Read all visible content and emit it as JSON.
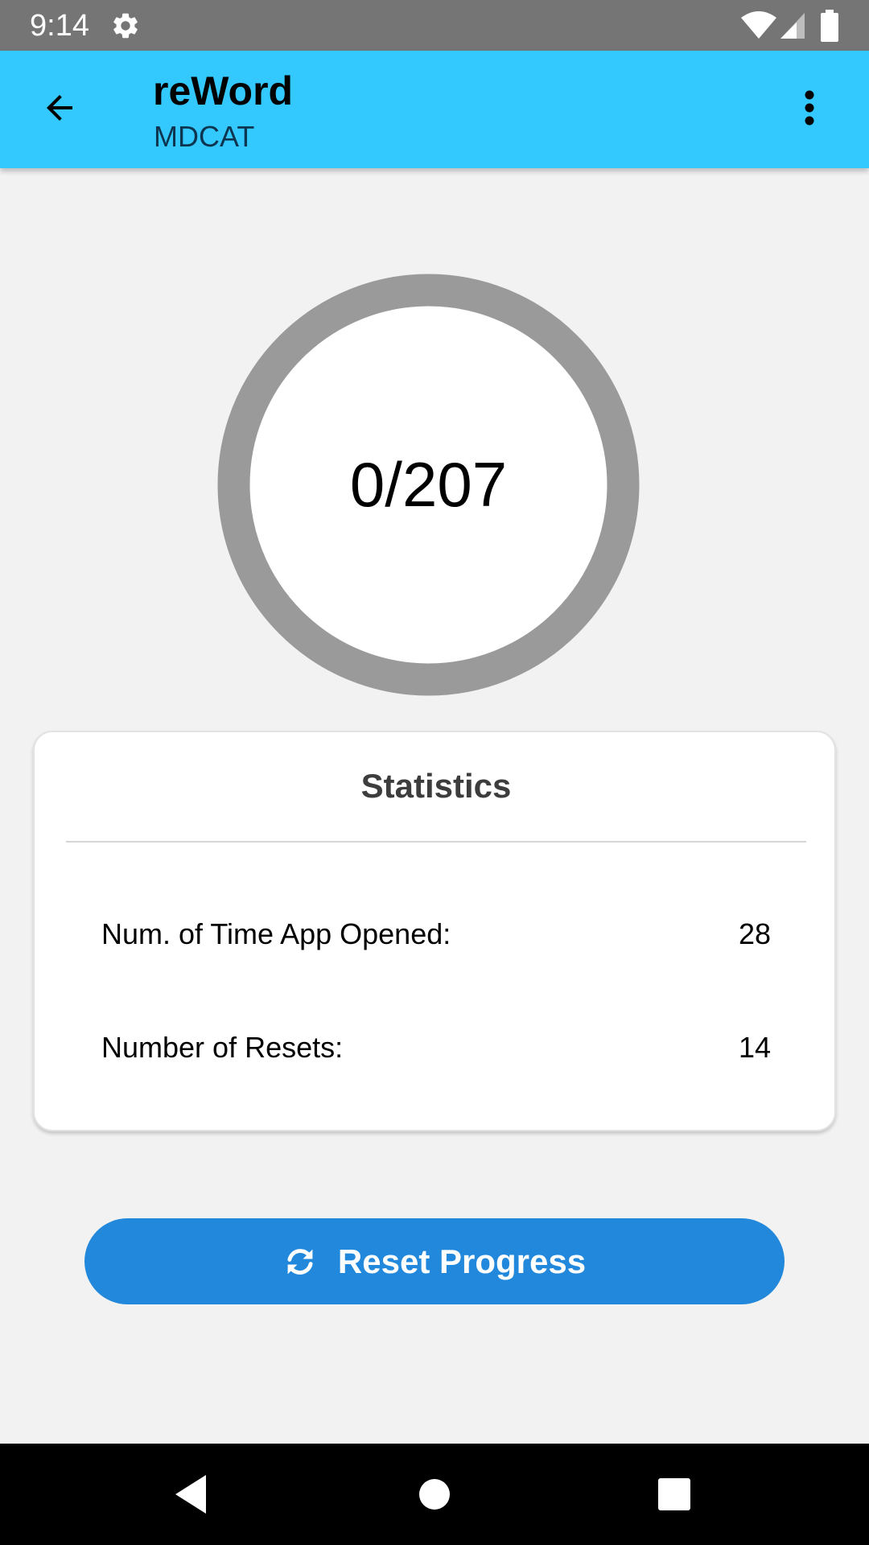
{
  "status_bar": {
    "time": "9:14",
    "icons": [
      "gear-icon",
      "wifi-icon",
      "signal-icon",
      "battery-icon"
    ]
  },
  "app_bar": {
    "back_icon": "arrow-back-icon",
    "title": "reWord",
    "subtitle": "MDCAT",
    "overflow_icon": "more-vert-icon",
    "background_color": "#33c9ff"
  },
  "progress": {
    "text": "0/207",
    "completed": 0,
    "total": 207,
    "ring_color": "#9a9a9a"
  },
  "statistics": {
    "title": "Statistics",
    "rows": [
      {
        "label": "Num. of Time App Opened:",
        "value": "28"
      },
      {
        "label": "Number of Resets:",
        "value": "14"
      }
    ]
  },
  "reset_button": {
    "icon": "refresh-icon",
    "label": "Reset Progress",
    "color": "#2188dc"
  },
  "nav_bar": {
    "icons": [
      "nav-back-icon",
      "nav-home-icon",
      "nav-recents-icon"
    ]
  }
}
